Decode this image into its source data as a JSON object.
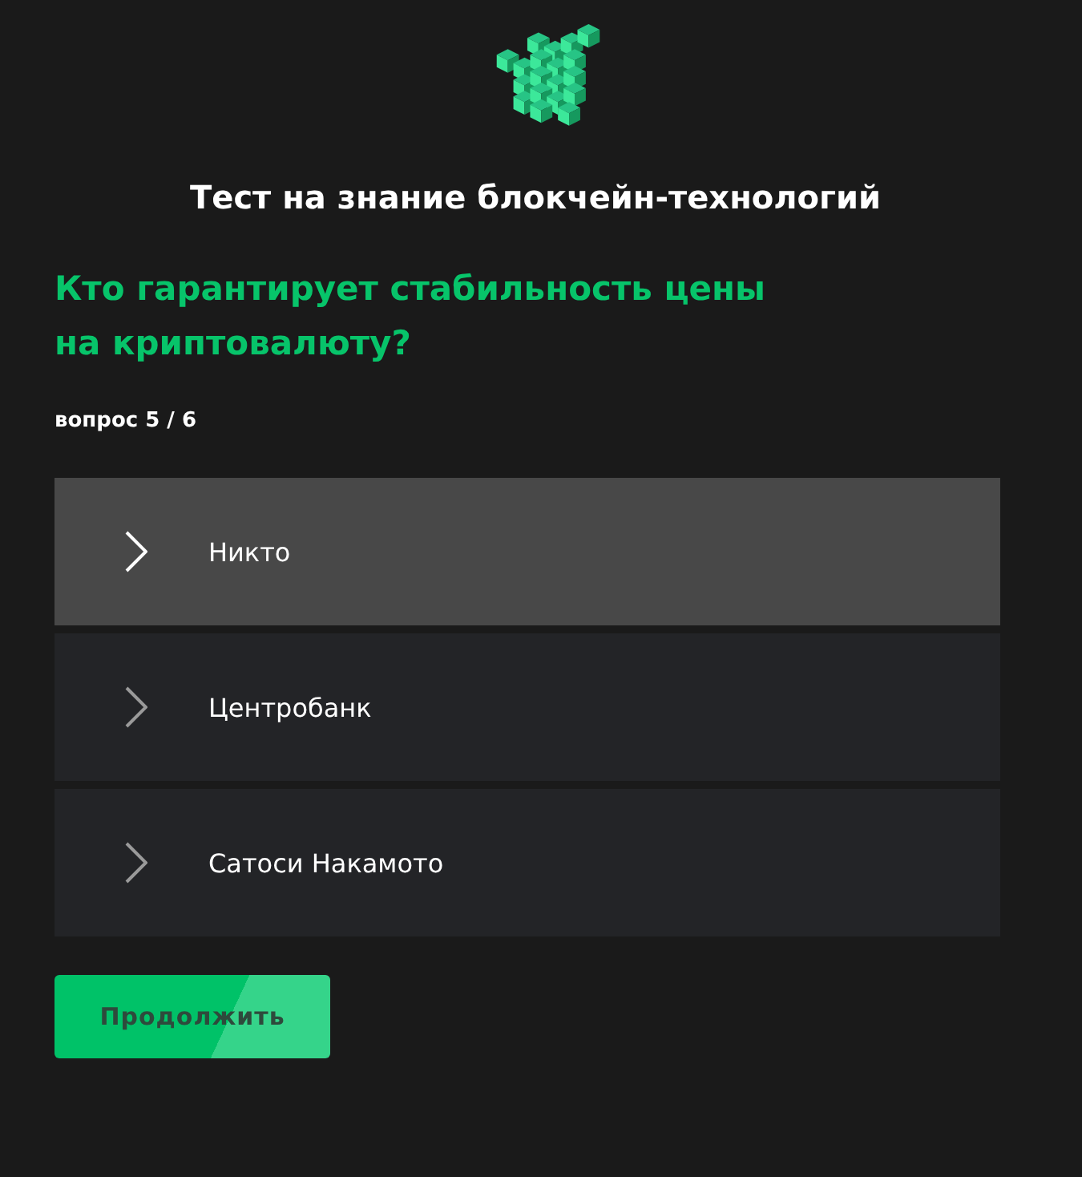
{
  "title": "Тест на знание блокчейн-технологий",
  "question": "Кто гарантирует стабильность цены на криптовалюту?",
  "progress": "вопрос 5 / 6",
  "options": [
    {
      "label": "Никто",
      "selected": true
    },
    {
      "label": "Центробанк",
      "selected": false
    },
    {
      "label": "Сатоси Накамото",
      "selected": false
    }
  ],
  "button": "Продолжить"
}
